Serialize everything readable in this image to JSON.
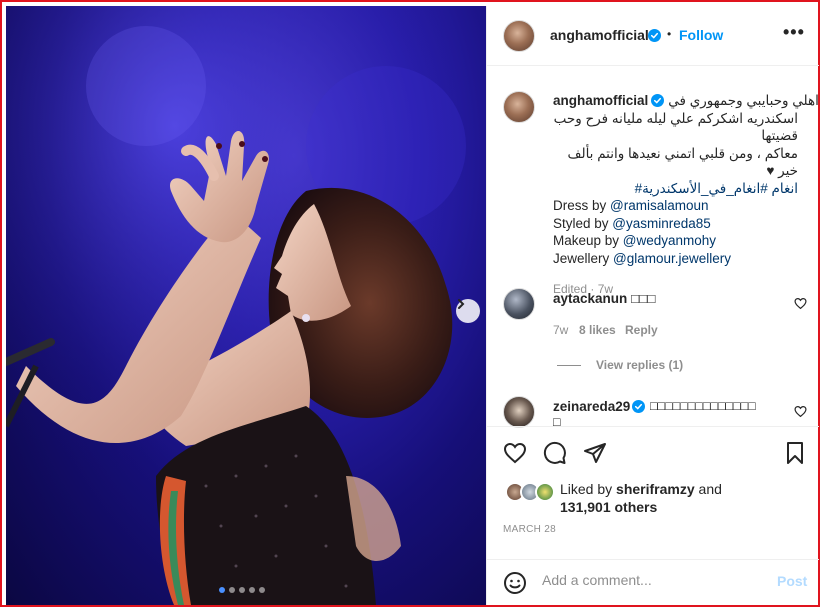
{
  "post": {
    "author": "anghamofficial",
    "follow_label": "Follow",
    "dot_sep": "•",
    "more_label": "•••",
    "caption_arabic": [
      "اهلي وحبايبي وجمهوري في",
      "اسكندريه اشكركم علي ليله مليانه فرح وحب قضيتها",
      "معاكم ، ومن قلبي اتمني نعيدها وانتم بألف خير ♥",
      "انغام #انغام_في_الأسكندرية#"
    ],
    "credits": [
      {
        "prefix": "Dress by ",
        "handle": "@ramisalamoun"
      },
      {
        "prefix": "Styled by ",
        "handle": "@yasminreda85"
      },
      {
        "prefix": "Makeup by ",
        "handle": "@wedyanmohy"
      },
      {
        "prefix": "Jewellery ",
        "handle": "@glamour.jewellery"
      }
    ],
    "edited_meta": "Edited · 7w",
    "carousel": {
      "count": 5,
      "active": 0
    }
  },
  "comments": [
    {
      "user": "aytackanun",
      "text": "□□□",
      "age": "7w",
      "likes": "8 likes",
      "reply_label": "Reply",
      "view_replies": "View replies (1)"
    },
    {
      "user": "zeinareda29",
      "text": "□□□□□□□□□□□□□□",
      "overflow": "□"
    }
  ],
  "engagement": {
    "liked_by_prefix": "Liked by ",
    "liked_by_user": "sheriframzy",
    "liked_by_and": " and",
    "others": "131,901 others",
    "date": "MARCH 28"
  },
  "add_comment": {
    "placeholder": "Add a comment...",
    "post_label": "Post"
  },
  "colors": {
    "accent": "#0095f6",
    "frame": "#e0141e",
    "stage_blue": "#2a1fb0"
  },
  "icons": [
    "next-arrow-icon",
    "verified-icon",
    "heart-icon",
    "comment-icon",
    "share-icon",
    "bookmark-icon",
    "emoji-icon"
  ]
}
